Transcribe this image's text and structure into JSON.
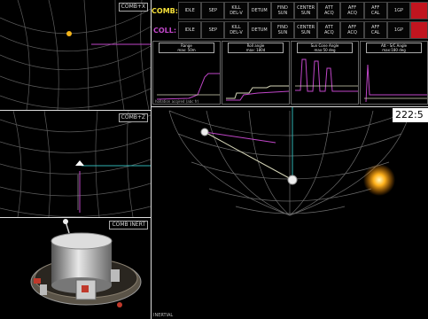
{
  "views": {
    "top_left": "COMB+X",
    "mid_left": "COMB+Z",
    "bottom_left": "COMB INERT",
    "main": "INERTIAL"
  },
  "comb_row": {
    "mode": "COMB:",
    "buttons": [
      "IDLE",
      "SEP",
      "KILL\nDEL-V",
      "DETUM",
      "FIND\nSUN",
      "CENTER\nSUN",
      "ATT\nACQ",
      "AFF\nACQ",
      "AFF\nCAL",
      "1GP"
    ]
  },
  "coll_row": {
    "mode": "COLL:",
    "buttons": [
      "IDLE",
      "SEP",
      "KILL\nDEL-V",
      "DETUM",
      "FIND\nSUN",
      "CENTER\nSUN",
      "ATT\nACQ",
      "AFF\nACQ",
      "AFF\nCAL",
      "1GP"
    ]
  },
  "plots": [
    {
      "title": "Range\nmax: 50m"
    },
    {
      "title": "Roll angle\nmax: 180d"
    },
    {
      "title": "Sun Cone Angle\nmax:50 deg"
    },
    {
      "title": "Att - S/C Angle\nmax:180 deg"
    }
  ],
  "plot_caption": "hollation acqired (abc fr)",
  "timer": "222:5",
  "colors": {
    "accent_yellow": "#f6e13a",
    "accent_magenta": "#c046c8",
    "alert_red": "#c1151f",
    "grid": "#6b6b6b",
    "sun": "#ffb21c"
  }
}
